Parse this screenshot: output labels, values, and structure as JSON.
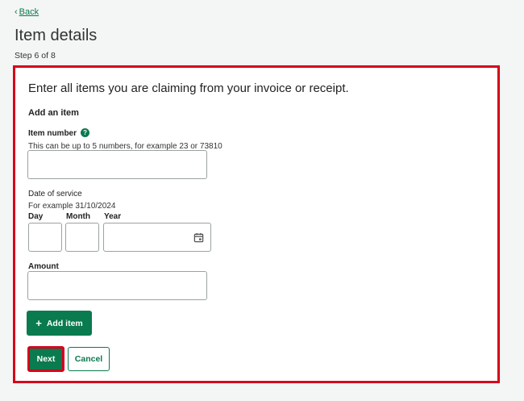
{
  "nav": {
    "back_label": "Back"
  },
  "header": {
    "title": "Item details",
    "step": "Step 6 of 8"
  },
  "form": {
    "intro": "Enter all items you are claiming from your invoice or receipt.",
    "section_heading": "Add an item",
    "item_number": {
      "label": "Item number",
      "hint": "This can be up to 5 numbers, for example 23 or 73810",
      "value": ""
    },
    "date_of_service": {
      "label": "Date of service",
      "hint": "For example 31/10/2024",
      "day_label": "Day",
      "month_label": "Month",
      "year_label": "Year",
      "day_value": "",
      "month_value": "",
      "year_value": ""
    },
    "amount": {
      "label": "Amount",
      "value": ""
    },
    "add_item_label": "Add item",
    "next_label": "Next",
    "cancel_label": "Cancel"
  },
  "icons": {
    "back": "chevron-left-icon",
    "help": "question-circle-icon",
    "calendar": "calendar-icon",
    "add": "plus-icon"
  },
  "colors": {
    "brand_green": "#0a7a4f",
    "highlight_red": "#d6001c",
    "page_background": "#f4f6f5"
  }
}
